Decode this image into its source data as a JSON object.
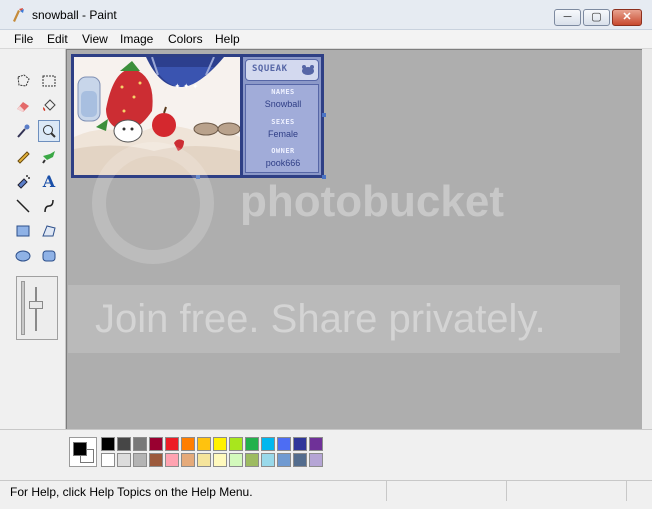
{
  "window": {
    "title": "snowball - Paint",
    "minimize_label": "─",
    "maximize_label": "▢",
    "close_label": "✕"
  },
  "menu": [
    "File",
    "Edit",
    "View",
    "Image",
    "Colors",
    "Help"
  ],
  "tools": [
    {
      "icon": "free-form-select-icon",
      "glyph": "⬠"
    },
    {
      "icon": "rect-select-icon",
      "glyph": "⬚"
    },
    {
      "icon": "eraser-icon",
      "glyph": "▰"
    },
    {
      "icon": "fill-icon",
      "glyph": "◈"
    },
    {
      "icon": "color-picker-icon",
      "glyph": "⁄"
    },
    {
      "icon": "magnifier-icon",
      "glyph": "🔍"
    },
    {
      "icon": "pencil-icon",
      "glyph": "✎"
    },
    {
      "icon": "brush-icon",
      "glyph": "➹"
    },
    {
      "icon": "airbrush-icon",
      "glyph": "⸙"
    },
    {
      "icon": "text-icon",
      "glyph": "A"
    },
    {
      "icon": "line-icon",
      "glyph": "╲"
    },
    {
      "icon": "curve-icon",
      "glyph": "∫"
    },
    {
      "icon": "rectangle-icon",
      "glyph": "▭"
    },
    {
      "icon": "polygon-icon",
      "glyph": "⏢"
    },
    {
      "icon": "ellipse-icon",
      "glyph": "⬭"
    },
    {
      "icon": "rounded-rectangle-icon",
      "glyph": "▢"
    }
  ],
  "active_tool": "magnifier-icon",
  "profile": {
    "header": "SQUEAK",
    "name_label": "NAMES",
    "name_value": "Snowball",
    "sex_label": "SEXES",
    "sex_value": "Female",
    "owner_label": "OWNER",
    "owner_value": "pook666"
  },
  "watermark": {
    "logo": "photobucket",
    "slogan": "Join free. Share privately."
  },
  "palette": {
    "row1": [
      "#000000",
      "#464646",
      "#787878",
      "#990030",
      "#ed1c24",
      "#ff7e00",
      "#ffc20e",
      "#fff200",
      "#a8e61d",
      "#22b14c",
      "#00b7ef",
      "#4d6df3",
      "#2f3699",
      "#6f3198"
    ],
    "row2": [
      "#ffffff",
      "#dcdcdc",
      "#b4b4b4",
      "#9c5a3c",
      "#ffa3b1",
      "#e5aa7a",
      "#f5e49c",
      "#fff9bd",
      "#d3f9bc",
      "#9dbb61",
      "#99d9ea",
      "#709ad1",
      "#546d8e",
      "#b5a5d5"
    ],
    "foreground": "#000000",
    "background": "#ffffff"
  },
  "status": {
    "text": "For Help, click Help Topics on the Help Menu."
  }
}
